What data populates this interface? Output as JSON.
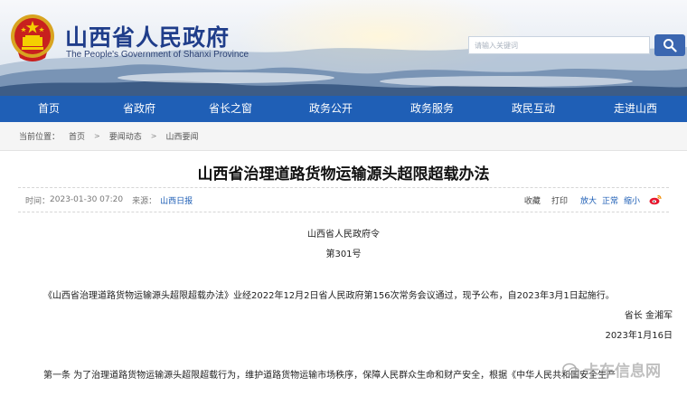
{
  "header": {
    "title": "山西省人民政府",
    "subtitle": "The People's Government of Shanxi Province",
    "search_placeholder": "请输入关键词"
  },
  "nav": {
    "items": [
      {
        "label": "首页"
      },
      {
        "label": "省政府"
      },
      {
        "label": "省长之窗"
      },
      {
        "label": "政务公开"
      },
      {
        "label": "政务服务"
      },
      {
        "label": "政民互动"
      },
      {
        "label": "走进山西"
      }
    ]
  },
  "breadcrumb": {
    "prefix": "当前位置：",
    "items": [
      "首页",
      "要闻动态",
      "山西要闻"
    ],
    "separator": ">"
  },
  "article": {
    "title": "山西省治理道路货物运输源头超限超载办法",
    "time_label": "时间：",
    "time": "2023-01-30 07:20",
    "source_label": "来源：",
    "source": "山西日报",
    "actions": {
      "favorite": "收藏",
      "print": "打印",
      "zoom_in": "放大",
      "normal": "正常",
      "zoom_out": "缩小"
    },
    "order_issuer": "山西省人民政府令",
    "order_number": "第301号",
    "intro": "《山西省治理道路货物运输源头超限超载办法》业经2022年12月2日省人民政府第156次常务会议通过，现予公布，自2023年3月1日起施行。",
    "signature": "省长 金湘军",
    "date": "2023年1月16日",
    "first_article": "第一条 为了治理道路货物运输源头超限超载行为，维护道路货物运输市场秩序，保障人民群众生命和财产安全，根据《中华人民共和国安全生产"
  },
  "watermark": {
    "text": "卡车信息网"
  },
  "colors": {
    "nav_bg": "#1f5fb6",
    "title_blue": "#1f3d8a",
    "search_btn": "#3b66b0"
  }
}
